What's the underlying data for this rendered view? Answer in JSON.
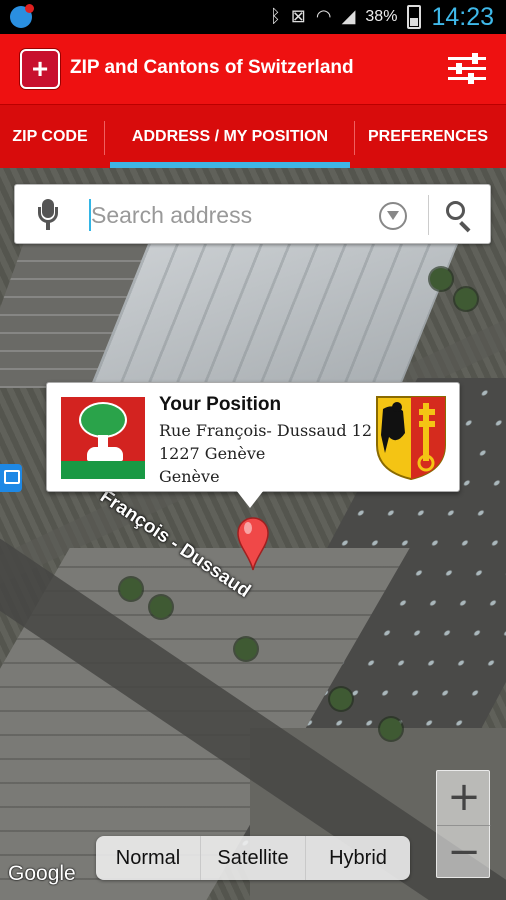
{
  "status_bar": {
    "battery_percent": "38%",
    "time": "14:23",
    "icons": [
      "notification-icon",
      "bluetooth-icon",
      "mute-icon",
      "wifi-icon",
      "signal-icon",
      "battery-icon"
    ]
  },
  "app_bar": {
    "title": "ZIP and Cantons of Switzerland",
    "logo_icon": "swiss-cross-icon",
    "settings_icon": "sliders-icon"
  },
  "tabs": [
    {
      "label": "ZIP CODE",
      "selected": false
    },
    {
      "label": "ADDRESS / MY POSITION",
      "selected": true
    },
    {
      "label": "PREFERENCES",
      "selected": false
    }
  ],
  "search": {
    "placeholder": "Search address",
    "value": ""
  },
  "info_window": {
    "title": "Your Position",
    "street": "Rue François- Dussaud 12",
    "zip_city": "1227 Genève",
    "canton": "Genève"
  },
  "map": {
    "street_label": "François - Dussaud",
    "map_types": [
      "Normal",
      "Satellite",
      "Hybrid"
    ],
    "zoom_in": "+",
    "zoom_out": "−",
    "attribution": "Google"
  },
  "colors": {
    "app_red": "#ee1111",
    "tab_indicator": "#3fb5e5",
    "time_color": "#3fb9ea"
  }
}
